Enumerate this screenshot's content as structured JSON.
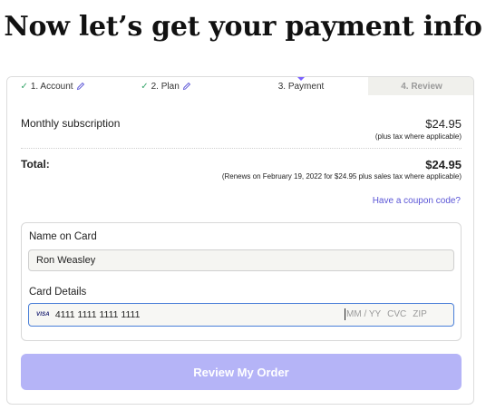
{
  "page": {
    "title": "Now let’s get your payment info"
  },
  "steps": [
    {
      "label": "1. Account",
      "status": "complete",
      "icon": "check-icon"
    },
    {
      "label": "2. Plan",
      "status": "complete",
      "icon": "check-icon"
    },
    {
      "label": "3. Payment",
      "status": "active"
    },
    {
      "label": "4. Review",
      "status": "pending"
    }
  ],
  "summary": {
    "subscription_label": "Monthly subscription",
    "subscription_amount": "$24.95",
    "subscription_note": "(plus tax where applicable)",
    "total_label": "Total:",
    "total_amount": "$24.95",
    "total_note": "(Renews on February 19, 2022 for $24.95 plus sales tax where applicable)"
  },
  "coupon": {
    "link_label": "Have a coupon code?"
  },
  "form": {
    "name_label": "Name on Card",
    "name_value": "Ron Weasley",
    "card_label": "Card Details",
    "card_brand": "VISA",
    "card_number": "4111 1111 1111 1111",
    "expiry_placeholder": "MM / YY",
    "cvc_placeholder": "CVC",
    "zip_placeholder": "ZIP"
  },
  "actions": {
    "review_label": "Review My Order"
  },
  "colors": {
    "accent": "#7b61ff",
    "button_disabled": "#b5b4f7",
    "link": "#5a55d6",
    "check": "#3aa76d",
    "focus_border": "#4a7fd8"
  }
}
